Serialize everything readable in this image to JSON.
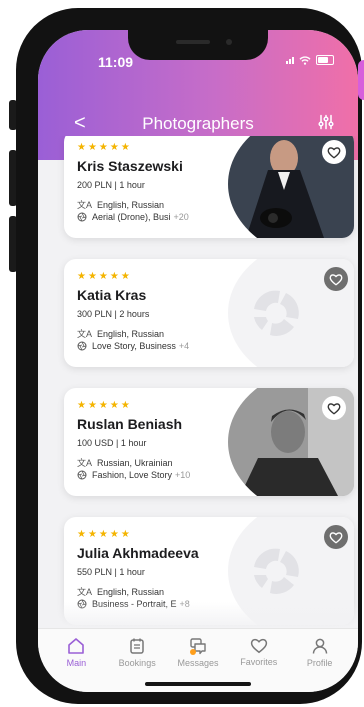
{
  "status_bar": {
    "time": "11:09"
  },
  "header": {
    "title": "Photographers",
    "back_label": "<"
  },
  "photographers": [
    {
      "rating_stars": "★★★★★",
      "name": "Kris Staszewski",
      "price": "200 PLN | 1 hour",
      "languages": "English, Russian",
      "categories": "Aerial (Drone), Busi",
      "more": "+20",
      "photo": "portrait-man-suit-icon"
    },
    {
      "rating_stars": "★★★★★",
      "name": "Katia Kras",
      "price": "300 PLN | 2 hours",
      "languages": "English, Russian",
      "categories": "Love Story, Business",
      "more": "+4",
      "photo": "placeholder-shutter-icon"
    },
    {
      "rating_stars": "★★★★★",
      "name": "Ruslan  Beniash",
      "price": "100 USD | 1 hour",
      "languages": "Russian, Ukrainian",
      "categories": "Fashion, Love Story",
      "more": "+10",
      "photo": "portrait-man-bw-icon"
    },
    {
      "rating_stars": "★★★★★",
      "name": "Julia  Akhmadeeva",
      "price": "550 PLN | 1 hour",
      "languages": "English, Russian",
      "categories": "Business - Portrait, E",
      "more": "+8",
      "photo": "placeholder-shutter-icon"
    }
  ],
  "tabs": [
    {
      "label": "Main",
      "icon": "home-icon",
      "active": true
    },
    {
      "label": "Bookings",
      "icon": "calendar-icon",
      "active": false
    },
    {
      "label": "Messages",
      "icon": "chat-icon",
      "active": false
    },
    {
      "label": "Favorites",
      "icon": "heart-icon",
      "active": false
    },
    {
      "label": "Profile",
      "icon": "user-icon",
      "active": false
    }
  ],
  "colors": {
    "accent_purple": "#9a5fd6",
    "accent_pink": "#f06fa8",
    "star": "#f4b400",
    "notification_dot": "#ff9f1c"
  }
}
